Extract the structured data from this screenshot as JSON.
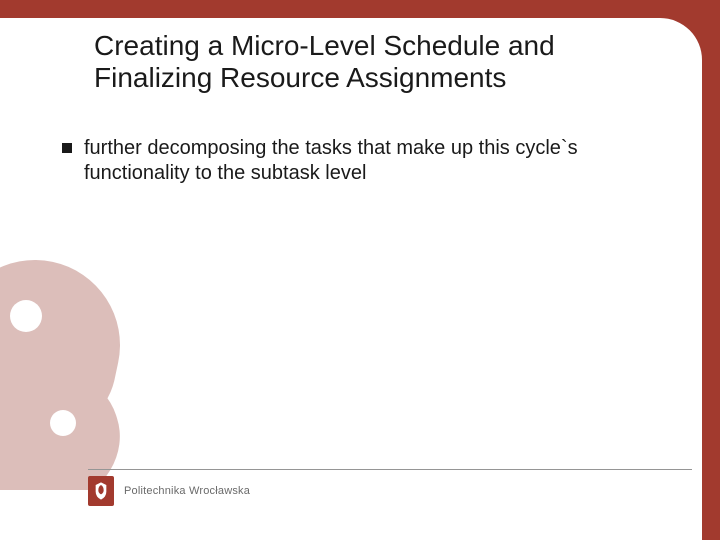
{
  "title": "Creating a Micro-Level Schedule and Finalizing Resource Assignments",
  "bullets": [
    "further decomposing the tasks that make up this cycle`s functionality to the subtask level"
  ],
  "footer": {
    "institution": "Politechnika Wrocławska"
  },
  "theme": {
    "accent": "#a23a2e",
    "muted_accent": "#c08a83",
    "text": "#1a1a1a",
    "footer_text": "#6a6a6a"
  }
}
